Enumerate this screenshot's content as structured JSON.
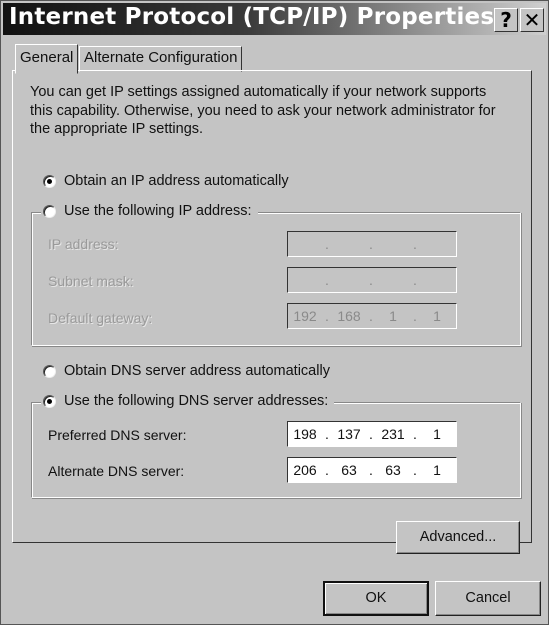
{
  "window": {
    "title": "Internet Protocol (TCP/IP) Properties",
    "help_button": "?",
    "close_button": "✕"
  },
  "tabs": [
    {
      "label": "General",
      "active": true
    },
    {
      "label": "Alternate Configuration",
      "active": false
    }
  ],
  "general": {
    "description": "You can get IP settings assigned automatically if your network supports this capability. Otherwise, you need to ask your network administrator for the appropriate IP settings.",
    "ip_mode": {
      "auto_label": "Obtain an IP address automatically",
      "manual_label": "Use the following IP address:",
      "selected": "auto"
    },
    "ip_fields": [
      {
        "label": "IP address:",
        "octets": [
          "",
          "",
          "",
          ""
        ],
        "enabled": false
      },
      {
        "label": "Subnet mask:",
        "octets": [
          "",
          "",
          "",
          ""
        ],
        "enabled": false
      },
      {
        "label": "Default gateway:",
        "octets": [
          "192",
          "168",
          "1",
          "1"
        ],
        "enabled": false
      }
    ],
    "dns_mode": {
      "auto_label": "Obtain DNS server address automatically",
      "manual_label": "Use the following DNS server addresses:",
      "selected": "manual"
    },
    "dns_fields": [
      {
        "label": "Preferred DNS server:",
        "octets": [
          "198",
          "137",
          "231",
          "1"
        ],
        "enabled": true
      },
      {
        "label": "Alternate DNS server:",
        "octets": [
          "206",
          "63",
          "63",
          "1"
        ],
        "enabled": true
      }
    ],
    "separator": ".",
    "advanced_button": "Advanced..."
  },
  "footer": {
    "ok_button": "OK",
    "cancel_button": "Cancel"
  }
}
